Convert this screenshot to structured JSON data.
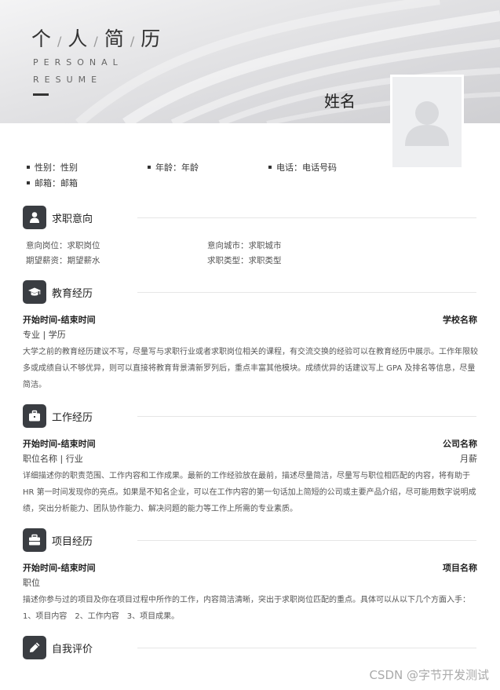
{
  "header": {
    "title_chars": [
      "个",
      "人",
      "简",
      "历"
    ],
    "title_separator": "/",
    "title_en_line1": "PERSONAL",
    "title_en_line2": "RESUME",
    "name": "姓名"
  },
  "basic_info": {
    "gender": "性别：性别",
    "age": "年龄：年龄",
    "phone": "电话：电话号码",
    "email": "邮箱：邮箱"
  },
  "sections": {
    "intention": {
      "title": "求职意向",
      "position": "意向岗位：求职岗位",
      "city": "意向城市：求职城市",
      "salary": "期望薪资：期望薪水",
      "type": "求职类型：求职类型"
    },
    "education": {
      "title": "教育经历",
      "time": "开始时间-结束时间",
      "org": "学校名称",
      "sub": "专业 | 学历",
      "desc": "大学之前的教育经历建议不写，尽量写与求职行业或者求职岗位相关的课程，有交流交换的经验可以在教育经历中展示。工作年限较多或成绩自认不够优异，则可以直接将教育背景清新罗列后，重点丰富其他模块。成绩优异的话建议写上 GPA 及排名等信息，尽量简洁。"
    },
    "work": {
      "title": "工作经历",
      "time": "开始时间-结束时间",
      "org": "公司名称",
      "sub": "职位名称 | 行业",
      "salary": "月薪",
      "desc": "详细描述你的职责范围、工作内容和工作成果。最新的工作经验放在最前，描述尽量简洁，尽量写与职位相匹配的内容，将有助于 HR 第一时间发现你的亮点。如果是不知名企业，可以在工作内容的第一句话加上简短的公司或主要产品介绍，尽可能用数字说明成绩，突出分析能力、团队协作能力、解决问题的能力等工作上所需的专业素质。"
    },
    "project": {
      "title": "项目经历",
      "time": "开始时间-结束时间",
      "org": "项目名称",
      "sub": "职位",
      "desc": "描述你参与过的项目及你在项目过程中所作的工作，内容简洁清晰，突出于求职岗位匹配的重点。具体可以从以下几个方面入手：1、项目内容　2、工作内容　3、项目成果。"
    },
    "self": {
      "title": "自我评价"
    }
  },
  "icons": {
    "intention": "person-icon",
    "education": "graduation-cap-icon",
    "work": "briefcase-icon",
    "project": "toolbox-icon",
    "self": "pen-icon"
  },
  "colors": {
    "icon_bg": "#3a3d42",
    "header_bg": "#dcdcde"
  },
  "watermark": "CSDN @字节开发测试"
}
